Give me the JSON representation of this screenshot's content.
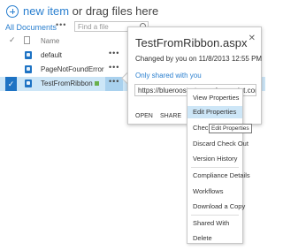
{
  "toolbar": {
    "new_item": "new item",
    "drag_text": " or drag files here",
    "view_label": "All Documents",
    "ellipsis": "•••",
    "search_placeholder": "Find a file"
  },
  "header": {
    "check": "✓",
    "name": "Name"
  },
  "rows": [
    {
      "name": "default",
      "ellipsis": "•••"
    },
    {
      "name": "PageNotFoundError",
      "ellipsis": "•••"
    },
    {
      "name": "TestFromRibbon",
      "ellipsis": "•••",
      "selected": true
    }
  ],
  "callout": {
    "title": "TestFromRibbon.aspx",
    "close": "✕",
    "changed": "Changed by you on 11/8/2013 12:55 PM",
    "shared": "Only shared with you",
    "url": "https://blueroosterteam.sharepoint.com/sites/…",
    "open": "OPEN",
    "share": "SHARE",
    "ellipsis": "•••"
  },
  "menu": {
    "items": [
      "View Properties",
      "Edit Properties",
      "Check Out",
      "Discard Check Out",
      "Version History",
      "Compliance Details",
      "Workflows",
      "Download a Copy",
      "Shared With",
      "Delete"
    ],
    "tooltip": "Edit Properties"
  },
  "colors": {
    "accent": "#2a7fcf",
    "selected_row": "#cde6f7",
    "file_icon": "#1e73c4"
  }
}
